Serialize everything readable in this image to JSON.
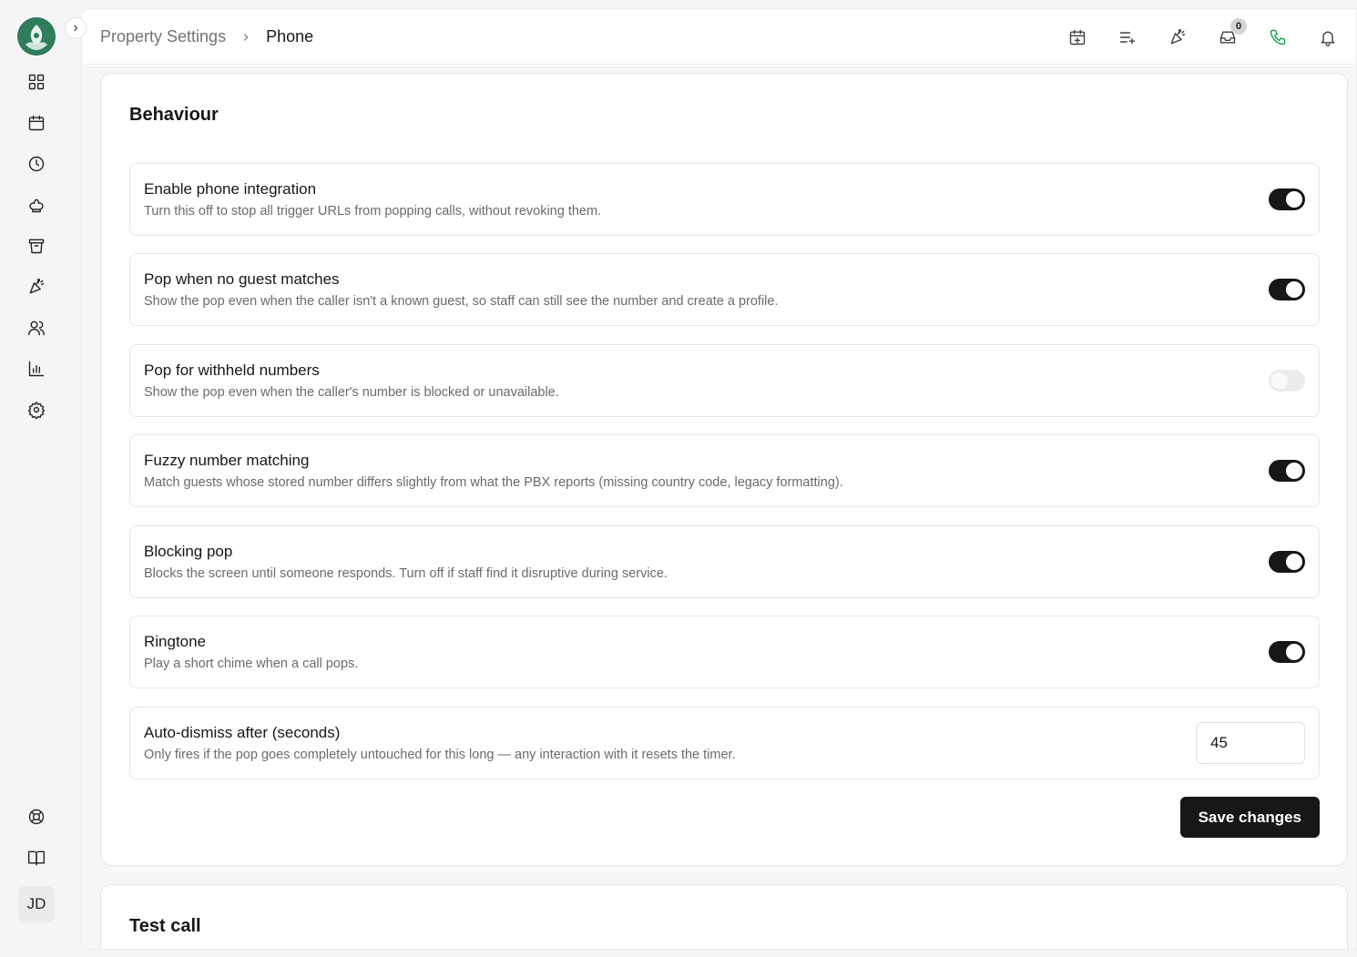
{
  "sidebar": {
    "avatar_initials": "JD",
    "icons": [
      "dashboard-icon",
      "calendar-icon",
      "clock-icon",
      "chef-hat-icon",
      "shopping-bag-icon",
      "party-popper-icon",
      "users-icon",
      "bar-chart-icon",
      "settings-icon",
      "lifebuoy-icon",
      "book-icon"
    ]
  },
  "breadcrumb": {
    "parent": "Property Settings",
    "current": "Phone"
  },
  "topbar": {
    "inbox_badge": "0",
    "icons": [
      "calendar-plus-icon",
      "list-plus-icon",
      "party-popper-icon",
      "inbox-icon",
      "phone-icon",
      "bell-icon"
    ],
    "phone_color": "#16a34a"
  },
  "behaviour": {
    "title": "Behaviour",
    "rows": [
      {
        "title": "Enable phone integration",
        "desc": "Turn this off to stop all trigger URLs from popping calls, without revoking them.",
        "enabled": true
      },
      {
        "title": "Pop when no guest matches",
        "desc": "Show the pop even when the caller isn't a known guest, so staff can still see the number and create a profile.",
        "enabled": true
      },
      {
        "title": "Pop for withheld numbers",
        "desc": "Show the pop even when the caller's number is blocked or unavailable.",
        "enabled": false
      },
      {
        "title": "Fuzzy number matching",
        "desc": "Match guests whose stored number differs slightly from what the PBX reports (missing country code, legacy formatting).",
        "enabled": true
      },
      {
        "title": "Blocking pop",
        "desc": "Blocks the screen until someone responds. Turn off if staff find it disruptive during service.",
        "enabled": true
      },
      {
        "title": "Ringtone",
        "desc": "Play a short chime when a call pops.",
        "enabled": true
      }
    ],
    "auto_dismiss": {
      "title": "Auto-dismiss after (seconds)",
      "desc": "Only fires if the pop goes completely untouched for this long — any interaction with it resets the timer.",
      "value": "45"
    },
    "save_label": "Save changes"
  },
  "test_call": {
    "title": "Test call"
  }
}
